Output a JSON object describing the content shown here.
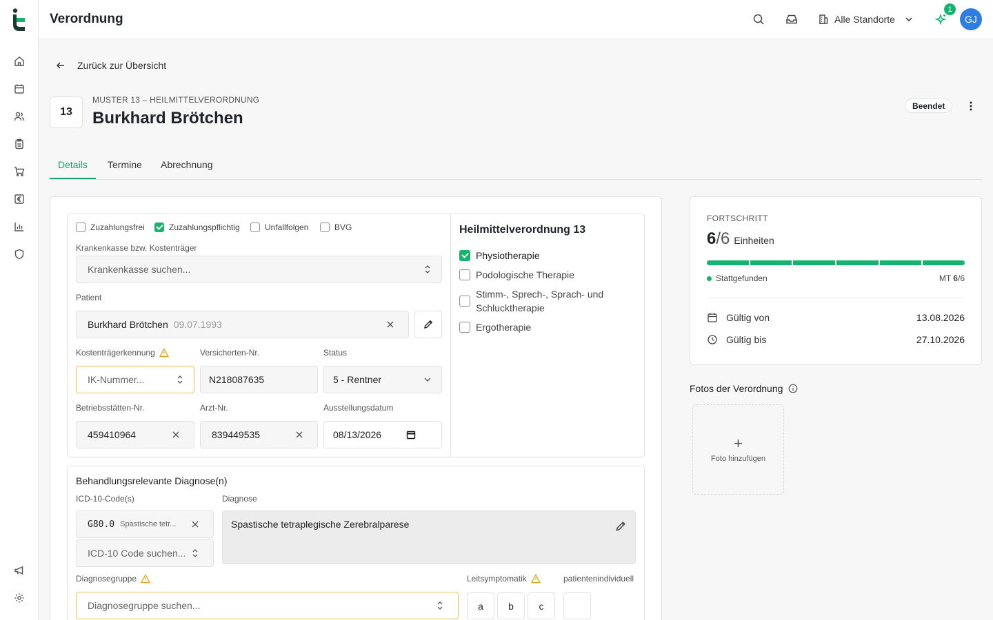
{
  "app": {
    "title": "Verordnung",
    "location_selector": "Alle Standorte",
    "notification_count": "1",
    "avatar_initials": "GJ"
  },
  "nav": {
    "back_label": "Zurück zur Übersicht"
  },
  "header": {
    "number": "13",
    "subtitle": "MUSTER 13 – HEILMITTELVERORDNUNG",
    "patient_name": "Burkhard Brötchen",
    "status": "Beendet"
  },
  "tabs": [
    {
      "label": "Details",
      "active": true
    },
    {
      "label": "Termine",
      "active": false
    },
    {
      "label": "Abrechnung",
      "active": false
    }
  ],
  "form": {
    "checkboxes": [
      {
        "label": "Zuzahlungsfrei",
        "checked": false
      },
      {
        "label": "Zuzahlungspflichtig",
        "checked": true
      },
      {
        "label": "Unfallfolgen",
        "checked": false
      },
      {
        "label": "BVG",
        "checked": false
      }
    ],
    "insurance_label": "Krankenkasse bzw. Kostenträger",
    "insurance_placeholder": "Krankenkasse suchen...",
    "patient_label": "Patient",
    "patient_name": "Burkhard Brötchen",
    "patient_birthdate": "09.07.1993",
    "ik_label": "Kostenträgerkennung",
    "ik_placeholder": "IK-Nummer...",
    "insured_no_label": "Versicherten-Nr.",
    "insured_no_value": "N218087635",
    "status_label": "Status",
    "status_value": "5 - Rentner",
    "site_no_label": "Betriebsstätten-Nr.",
    "site_no_value": "459410964",
    "doctor_no_label": "Arzt-Nr.",
    "doctor_no_value": "839449535",
    "issue_date_label": "Ausstellungsdatum",
    "issue_date_value": "08/13/2026"
  },
  "therapy": {
    "title": "Heilmittelverordnung 13",
    "items": [
      {
        "label": "Physiotherapie",
        "checked": true
      },
      {
        "label": "Podologische Therapie",
        "checked": false
      },
      {
        "label": "Stimm-, Sprech-, Sprach- und Schlucktherapie",
        "checked": false
      },
      {
        "label": "Ergotherapie",
        "checked": false
      }
    ]
  },
  "diagnosis": {
    "title": "Behandlungsrelevante Diagnose(n)",
    "icd_label": "ICD-10-Code(s)",
    "icd_code": "G80.0",
    "icd_desc_short": "Spastische tetr...",
    "icd_search_placeholder": "ICD-10 Code suchen...",
    "diagnosis_label": "Diagnose",
    "diagnosis_text": "Spastische tetraplegische Zerebralparese",
    "group_label": "Diagnosegruppe",
    "group_placeholder": "Diagnosegruppe suchen...",
    "leitsymptomatik_label": "Leitsymptomatik",
    "leitsymptomatik_options": [
      "a",
      "b",
      "c"
    ],
    "individual_label": "patientenindividuell"
  },
  "progress": {
    "label": "FORTSCHRITT",
    "done": "6",
    "total": "/6",
    "unit": "Einheiten",
    "segments": 6,
    "fraction": 1.0,
    "legend": "Stattgefunden",
    "mt_prefix": "MT",
    "mt_done": "6",
    "mt_total": "/6",
    "valid_from_label": "Gültig von",
    "valid_from_value": "13.08.2026",
    "valid_to_label": "Gültig bis",
    "valid_to_value": "27.10.2026"
  },
  "photos": {
    "title": "Fotos der Verordnung",
    "add_label": "Foto hinzufügen"
  },
  "colors": {
    "accent": "#16b36e",
    "warning": "#e2a11b",
    "avatar": "#2f7de1"
  }
}
